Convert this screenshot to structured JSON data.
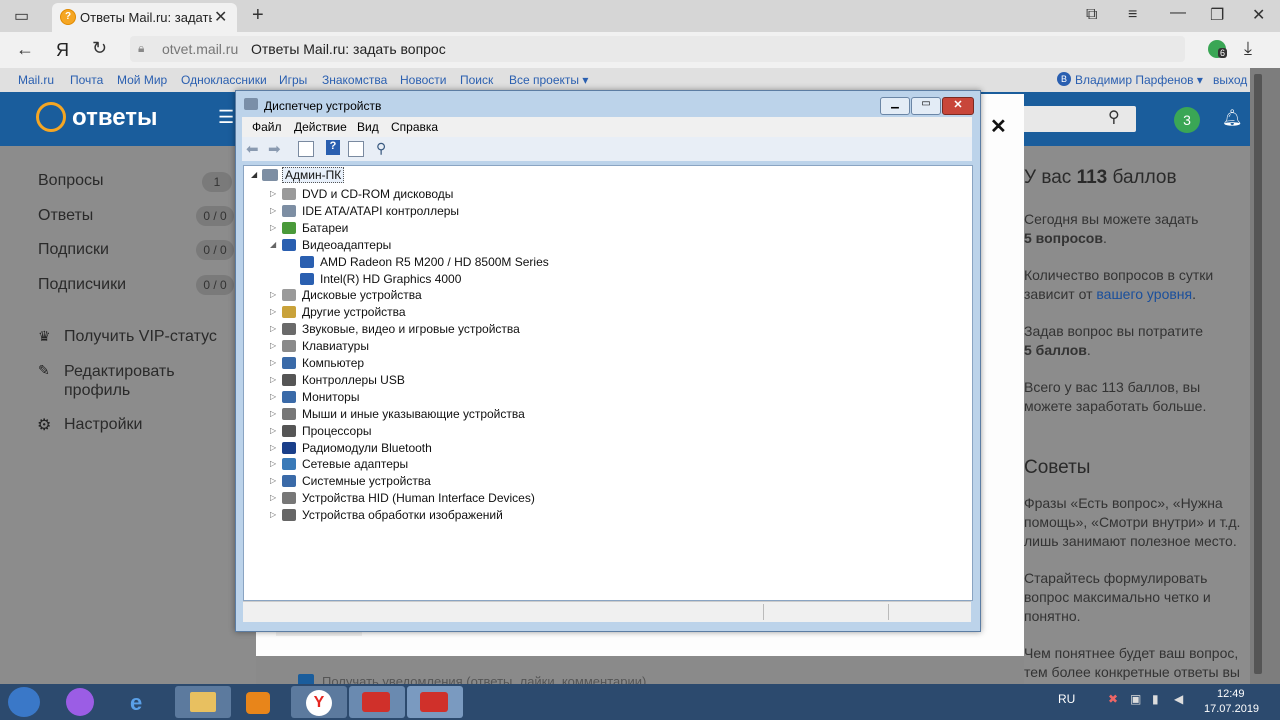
{
  "browser": {
    "tab_title": "Ответы Mail.ru: задать в",
    "url_domain": "otvet.mail.ru",
    "url_title": "Ответы Mail.ru: задать вопрос",
    "yandex_logo": "Я",
    "extension_badge": "6"
  },
  "top_nav": {
    "links": [
      "Mail.ru",
      "Почта",
      "Мой Мир",
      "Одноклассники",
      "Игры",
      "Знакомства",
      "Новости",
      "Поиск",
      "Все проекты ▾"
    ],
    "user": "Владимир Парфенов ▾",
    "user_initial": "В",
    "logout": "выход"
  },
  "site": {
    "logo": "ответы",
    "level_badge": "3",
    "close_symbol": "✕"
  },
  "sidebar": {
    "items": [
      {
        "label": "Вопросы",
        "count": "1"
      },
      {
        "label": "Ответы",
        "count": "0 / 0"
      },
      {
        "label": "Подписки",
        "count": "0 / 0"
      },
      {
        "label": "Подписчики",
        "count": "0 / 0"
      }
    ],
    "actions": [
      {
        "label": "Получить VIP-статус"
      },
      {
        "label": "Редактировать профиль"
      },
      {
        "label": "Настройки"
      }
    ]
  },
  "right_panel": {
    "heading_prefix": "У вас ",
    "heading_points": "113",
    "heading_suffix": " баллов",
    "p1_a": "Сегодня вы можете задать",
    "p1_b": "5 вопросов",
    "p1_c": ".",
    "p2_a": "Количество вопросов в сутки зависит от ",
    "p2_link": "вашего уровня",
    "p2_c": ".",
    "p3_a": "Задав вопрос вы потратите",
    "p3_b": "5 баллов",
    "p3_c": ".",
    "p4": "Всего у вас 113 баллов, вы можете заработать больше.",
    "tips_heading": "Советы",
    "tip1": "Фразы «Есть вопрос», «Нужна помощь», «Смотри внутри» и т.д. лишь занимают полезное место.",
    "tip2": "Старайтесь формулировать вопрос максимально четко и понятно.",
    "tip3": "Чем понятнее будет ваш вопрос, тем более конкретные ответы вы"
  },
  "modal_footer_text": "Получать уведомления (ответы, лайки, комментарии)",
  "device_manager": {
    "title": "Диспетчер устройств",
    "menu": [
      "Файл",
      "Действие",
      "Вид",
      "Справка"
    ],
    "root": "Админ-ПК",
    "tree": [
      {
        "label": "DVD и CD-ROM дисководы",
        "level": 1,
        "exp": "▷",
        "color": "#9a9a9a"
      },
      {
        "label": "IDE ATA/ATAPI контроллеры",
        "level": 1,
        "exp": "▷",
        "color": "#7d8ea3"
      },
      {
        "label": "Батареи",
        "level": 1,
        "exp": "▷",
        "color": "#4a9a3a"
      },
      {
        "label": "Видеоадаптеры",
        "level": 1,
        "exp": "◢",
        "color": "#2a5fb0"
      },
      {
        "label": "AMD Radeon R5 M200 / HD 8500M Series",
        "level": 2,
        "exp": "",
        "color": "#2a5fb0"
      },
      {
        "label": "Intel(R) HD Graphics 4000",
        "level": 2,
        "exp": "",
        "color": "#2a5fb0"
      },
      {
        "label": "Дисковые устройства",
        "level": 1,
        "exp": "▷",
        "color": "#9a9a9a"
      },
      {
        "label": "Другие устройства",
        "level": 1,
        "exp": "▷",
        "color": "#c9a23a"
      },
      {
        "label": "Звуковые, видео и игровые устройства",
        "level": 1,
        "exp": "▷",
        "color": "#6a6a6a"
      },
      {
        "label": "Клавиатуры",
        "level": 1,
        "exp": "▷",
        "color": "#8a8a8a"
      },
      {
        "label": "Компьютер",
        "level": 1,
        "exp": "▷",
        "color": "#3a6aa8"
      },
      {
        "label": "Контроллеры USB",
        "level": 1,
        "exp": "▷",
        "color": "#555555"
      },
      {
        "label": "Мониторы",
        "level": 1,
        "exp": "▷",
        "color": "#3a6aa8"
      },
      {
        "label": "Мыши и иные указывающие устройства",
        "level": 1,
        "exp": "▷",
        "color": "#777777"
      },
      {
        "label": "Процессоры",
        "level": 1,
        "exp": "▷",
        "color": "#555555"
      },
      {
        "label": "Радиомодули Bluetooth",
        "level": 1,
        "exp": "▷",
        "color": "#1a3f8a"
      },
      {
        "label": "Сетевые адаптеры",
        "level": 1,
        "exp": "▷",
        "color": "#3a7ab8"
      },
      {
        "label": "Системные устройства",
        "level": 1,
        "exp": "▷",
        "color": "#3a6aa8"
      },
      {
        "label": "Устройства HID (Human Interface Devices)",
        "level": 1,
        "exp": "▷",
        "color": "#777777"
      },
      {
        "label": "Устройства обработки изображений",
        "level": 1,
        "exp": "▷",
        "color": "#666666"
      }
    ]
  },
  "taskbar": {
    "lang": "RU",
    "time": "12:49",
    "date": "17.07.2019"
  },
  "colors": {
    "site_blue": "#1a5d9c",
    "brand_orange": "#f5a623",
    "link": "#2a5fb0",
    "level_green": "#3aa655"
  }
}
